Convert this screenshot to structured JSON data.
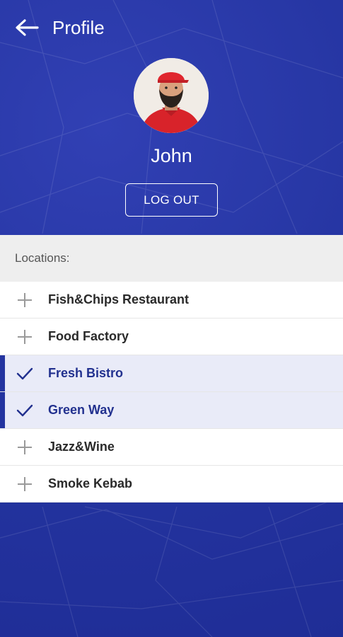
{
  "header": {
    "title": "Profile",
    "user_name": "John",
    "logout_label": "LOG OUT"
  },
  "locations": {
    "heading": "Locations:",
    "items": [
      {
        "label": "Fish&Chips Restaurant",
        "selected": false,
        "icon": "plus-icon"
      },
      {
        "label": "Food Factory",
        "selected": false,
        "icon": "plus-icon"
      },
      {
        "label": "Fresh Bistro",
        "selected": true,
        "icon": "check-icon"
      },
      {
        "label": "Green Way",
        "selected": true,
        "icon": "check-icon"
      },
      {
        "label": "Jazz&Wine",
        "selected": false,
        "icon": "plus-icon"
      },
      {
        "label": "Smoke Kebab",
        "selected": false,
        "icon": "plus-icon"
      }
    ]
  },
  "colors": {
    "brand": "#2434a0",
    "selected_bg": "#e9ebf8",
    "selected_text": "#22318f"
  }
}
